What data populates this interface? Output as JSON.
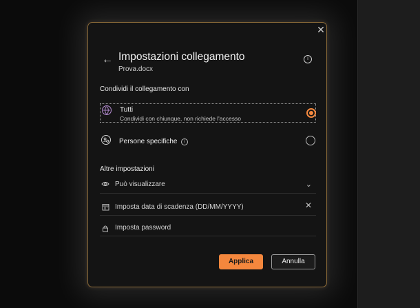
{
  "dialog": {
    "title": "Impostazioni collegamento",
    "file_name": "Prova.docx",
    "close_glyph": "✕",
    "back_glyph": "←",
    "info_glyph": "i"
  },
  "share_with": {
    "section_label": "Condividi il collegamento con",
    "options": [
      {
        "label": "Tutti",
        "description": "Condividi con chiunque, non richiede l'accesso",
        "icon": "globe-icon",
        "selected": true
      },
      {
        "label": "Persone specifiche",
        "description": "",
        "icon": "people-icon",
        "selected": false
      }
    ]
  },
  "other_settings": {
    "section_label": "Altre impostazioni",
    "permission": {
      "label": "Può visualizzare",
      "icon": "eye-icon"
    },
    "expiry": {
      "placeholder": "Imposta data di scadenza (DD/MM/YYYY)",
      "icon": "calendar-icon"
    },
    "password": {
      "placeholder": "Imposta password",
      "icon": "lock-icon"
    }
  },
  "buttons": {
    "apply": "Applica",
    "cancel": "Annulla"
  },
  "colors": {
    "accent": "#f4873d",
    "dialog_border": "#8a6a38",
    "background": "#141414"
  }
}
